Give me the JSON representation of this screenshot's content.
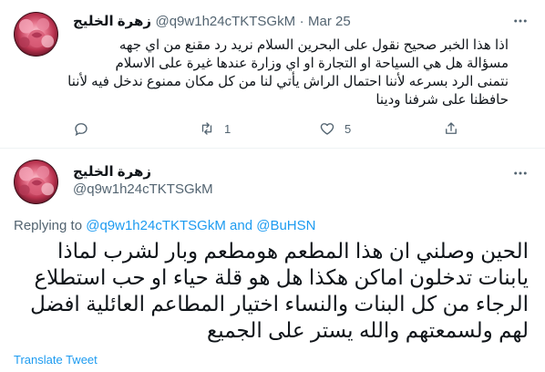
{
  "tweet1": {
    "author_name": "زهرة الخليج",
    "handle": "@q9w1h24cTKTSGkM",
    "separator": "·",
    "date": "Mar 25",
    "body_lines": [
      "اذا هذا الخبر صحيح نقول على البحرين السلام نريد   رد مقنع من اي جهه",
      "مسؤالة هل  هي السياحة او التجارة او اي وزارة عندها  غيرة على الاسلام",
      "نتمنى الرد بسرعه لأننا احتمال  الراش  يأتي لنا من كل مكان ممنوع ندخل فيه لأننا",
      "حافظنا على شرفنا ودينا"
    ],
    "actions": {
      "reply_count": "",
      "retweet_count": "1",
      "like_count": "5"
    }
  },
  "tweet2": {
    "author_name": "زهرة الخليج",
    "handle": "@q9w1h24cTKTSGkM",
    "replying_prefix": "Replying to",
    "replying_to_1": "@q9w1h24cTKTSGkM",
    "replying_and": "and",
    "replying_to_2": "@BuHSN",
    "body_lines": [
      "الحين وصلني  ان هذا المطعم هومطعم وبار لشرب  لماذا",
      "يابنات تدخلون اماكن هكذا هل  هو قلة حياء او حب استطلاع",
      "الرجاء من كل البنات والنساء اختيار المطاعم العائلية  افضل",
      "لهم ولسمعتهم والله يستر على الجميع"
    ],
    "translate_label": "Translate Tweet"
  },
  "icons": {
    "reply": "reply-icon",
    "retweet": "retweet-icon",
    "like": "heart-icon",
    "share": "share-icon",
    "more": "more-icon"
  },
  "colors": {
    "link": "#1d9bf0",
    "secondary_text": "#536471",
    "primary_text": "#0f1419",
    "divider": "#eff3f4"
  }
}
